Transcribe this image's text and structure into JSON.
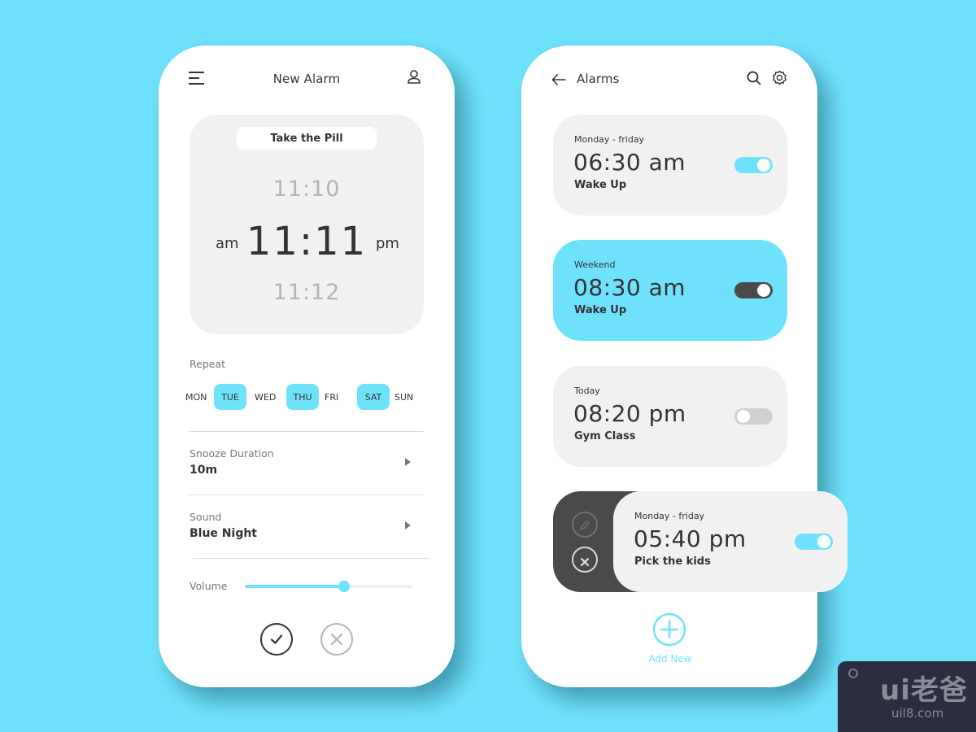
{
  "new_alarm_screen": {
    "header": {
      "menu_icon": "hamburger-menu-icon",
      "title": "New Alarm",
      "profile_icon": "user-icon"
    },
    "time_picker": {
      "label": "Take the Pill",
      "previous_time": "11:10",
      "selected_time": "11:11",
      "next_time": "11:12",
      "am_label": "am",
      "pm_label": "pm"
    },
    "repeat": {
      "label": "Repeat",
      "days": [
        {
          "label": "MON",
          "selected": false
        },
        {
          "label": "TUE",
          "selected": true
        },
        {
          "label": "WED",
          "selected": false
        },
        {
          "label": "THU",
          "selected": true
        },
        {
          "label": "FRI",
          "selected": false
        },
        {
          "label": "SAT",
          "selected": true
        },
        {
          "label": "SUN",
          "selected": false
        }
      ]
    },
    "snooze": {
      "label": "Snooze Duration",
      "value": "10m"
    },
    "sound": {
      "label": "Sound",
      "value": "Blue Night"
    },
    "volume": {
      "label": "Volume",
      "level_percent": 59
    },
    "confirm_icon": "check-circle-icon",
    "cancel_icon": "close-circle-icon"
  },
  "alarms_screen": {
    "header": {
      "back_icon": "arrow-left-icon",
      "title": "Alarms",
      "search_icon": "search-icon",
      "settings_icon": "gear-icon"
    },
    "alarms": [
      {
        "days": "Monday - friday",
        "time": "06:30 am",
        "name": "Wake Up",
        "enabled": true,
        "highlighted": false
      },
      {
        "days": "Weekend",
        "time": "08:30 am",
        "name": "Wake Up",
        "enabled": true,
        "highlighted": true
      },
      {
        "days": "Today",
        "time": "08:20 pm",
        "name": "Gym Class",
        "enabled": false,
        "highlighted": false
      },
      {
        "days": "Monday - friday",
        "time": "05:40 pm",
        "name": "Pick the kids",
        "enabled": true,
        "highlighted": false,
        "swiped": true
      }
    ],
    "swipe_actions": {
      "edit_icon": "pencil-icon",
      "delete_icon": "close-circle-icon"
    },
    "add_new": {
      "label": "Add New",
      "icon": "plus-circle-icon"
    }
  },
  "colors": {
    "background": "#6fe2fb",
    "accent": "#6fe2fb",
    "card": "#f1f1f1",
    "dark": "#4a4a4a",
    "text": "#333333"
  },
  "watermark": {
    "logo": "ui老爸",
    "url": "uil8.com"
  }
}
